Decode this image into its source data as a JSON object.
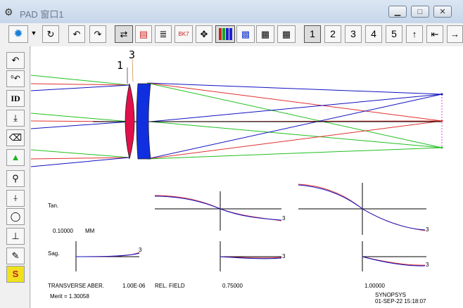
{
  "window": {
    "title": "PAD 窗口1",
    "app_icon": "synopsys-logo-icon",
    "minimize_glyph": "▁",
    "maximize_glyph": "□",
    "close_glyph": "✕"
  },
  "toolbar": {
    "buttons": [
      {
        "name": "settings-gear",
        "glyph": "✹"
      },
      {
        "name": "dropdown-arrow",
        "glyph": "▼"
      },
      {
        "name": "refresh",
        "glyph": "↻"
      },
      {
        "name": "undo",
        "glyph": "↶"
      },
      {
        "name": "redo",
        "glyph": "↷"
      },
      {
        "name": "swap",
        "glyph": "⇄"
      },
      {
        "name": "layout",
        "glyph": "▤"
      },
      {
        "name": "list",
        "glyph": "≣"
      },
      {
        "name": "glass-catalog",
        "glyph": "BK7"
      },
      {
        "name": "expand",
        "glyph": "✥"
      },
      {
        "name": "color-bars",
        "glyph": ""
      },
      {
        "name": "spot-diagram",
        "glyph": ""
      },
      {
        "name": "grid-a",
        "glyph": "▦"
      },
      {
        "name": "grid-b",
        "glyph": "▦"
      }
    ],
    "pages": [
      "1",
      "2",
      "3",
      "4",
      "5"
    ],
    "nav": {
      "up": "↑",
      "first": "⇤",
      "next": "→"
    }
  },
  "left_toolbar": {
    "buttons": [
      {
        "name": "undo-icon",
        "glyph": "↶"
      },
      {
        "name": "zero-undo-icon",
        "glyph": "⁰↶"
      },
      {
        "name": "id-button",
        "glyph": "ID"
      },
      {
        "name": "download-icon",
        "glyph": "⤓"
      },
      {
        "name": "eraser-icon",
        "glyph": "⌫"
      },
      {
        "name": "green-triangle-icon",
        "glyph": "▲"
      },
      {
        "name": "tree-icon",
        "glyph": "⚲"
      },
      {
        "name": "branch-icon",
        "glyph": "⍭"
      },
      {
        "name": "circle-icon",
        "glyph": "◯"
      },
      {
        "name": "axis-icon",
        "glyph": "⊥"
      },
      {
        "name": "pencil-icon",
        "glyph": "✎"
      },
      {
        "name": "synopsys-s-icon",
        "glyph": "S"
      }
    ]
  },
  "lens_labels": {
    "surface1": "1",
    "surface3": "3"
  },
  "aberration": {
    "tan_label": "Tan.",
    "sag_label": "Sag.",
    "scale_value": "0.10000",
    "scale_unit": "MM",
    "curve_label": "3",
    "title": "TRANSVERSE ABER.",
    "wavelength": "1.00E-06",
    "rel_field_label": "REL. FIELD",
    "field_mid": "0.75000",
    "field_full": "1.00000",
    "merit": "Merit = 1.30058",
    "vendor": "SYNOPSYS",
    "timestamp": "01-SEP-22  15:18:07"
  },
  "colors": {
    "ray_red": "#e03030",
    "ray_green": "#20c020",
    "ray_blue": "#1010c0",
    "lens1": "#e0104a",
    "lens2": "#1030e0"
  }
}
